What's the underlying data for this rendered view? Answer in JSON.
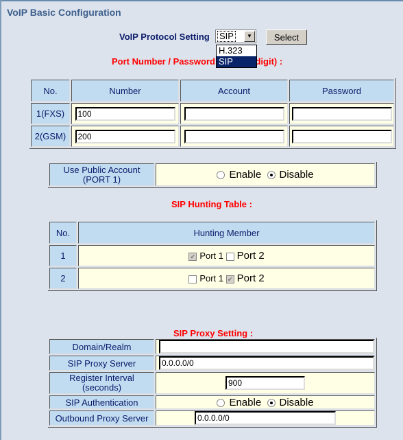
{
  "page_title": "VoIP Basic Configuration",
  "protocol": {
    "label": "VoIP Protocol Setting",
    "selected": "SIP",
    "options": [
      "H.323",
      "SIP"
    ],
    "select_button": "Select"
  },
  "port_section": {
    "title": "Port Number / Password (MAX 20 digit) :",
    "headers": [
      "No.",
      "Number",
      "Account",
      "Password"
    ],
    "rows": [
      {
        "no": "1(FXS)",
        "number": "100",
        "account": "",
        "password": ""
      },
      {
        "no": "2(GSM)",
        "number": "200",
        "account": "",
        "password": ""
      }
    ]
  },
  "public_account": {
    "label_line1": "Use Public Account",
    "label_line2": "(PORT 1)",
    "enable": "Enable",
    "disable": "Disable",
    "value": "Disable"
  },
  "hunting": {
    "title": "SIP Hunting Table :",
    "headers": [
      "No.",
      "Hunting Member"
    ],
    "rows": [
      {
        "no": "1",
        "port1_label": "Port 1",
        "port1": true,
        "port2_label": "Port 2",
        "port2": false
      },
      {
        "no": "2",
        "port1_label": "Port 1",
        "port1": false,
        "port2_label": "Port 2",
        "port2": true
      }
    ]
  },
  "proxy": {
    "title": "SIP Proxy Setting :",
    "domain_label": "Domain/Realm",
    "domain_value": "",
    "server_label": "SIP Proxy Server",
    "server_value": "0.0.0.0/0",
    "interval_label1": "Register Interval",
    "interval_label2": "(seconds)",
    "interval_value": "900",
    "auth_label": "SIP Authentication",
    "auth_enable": "Enable",
    "auth_disable": "Disable",
    "auth_value": "Disable",
    "outbound_label": "Outbound Proxy Server",
    "outbound_value": "0.0.0.0/0"
  }
}
